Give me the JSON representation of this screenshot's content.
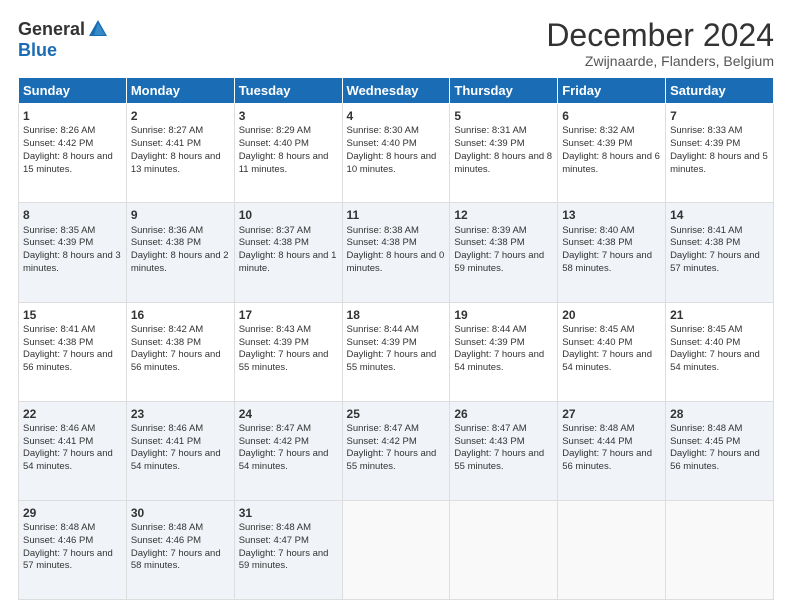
{
  "logo": {
    "general": "General",
    "blue": "Blue"
  },
  "header": {
    "title": "December 2024",
    "subtitle": "Zwijnaarde, Flanders, Belgium"
  },
  "days": [
    "Sunday",
    "Monday",
    "Tuesday",
    "Wednesday",
    "Thursday",
    "Friday",
    "Saturday"
  ],
  "weeks": [
    [
      {
        "day": "1",
        "sunrise": "8:26 AM",
        "sunset": "4:42 PM",
        "daylight": "8 hours and 15 minutes."
      },
      {
        "day": "2",
        "sunrise": "8:27 AM",
        "sunset": "4:41 PM",
        "daylight": "8 hours and 13 minutes."
      },
      {
        "day": "3",
        "sunrise": "8:29 AM",
        "sunset": "4:40 PM",
        "daylight": "8 hours and 11 minutes."
      },
      {
        "day": "4",
        "sunrise": "8:30 AM",
        "sunset": "4:40 PM",
        "daylight": "8 hours and 10 minutes."
      },
      {
        "day": "5",
        "sunrise": "8:31 AM",
        "sunset": "4:39 PM",
        "daylight": "8 hours and 8 minutes."
      },
      {
        "day": "6",
        "sunrise": "8:32 AM",
        "sunset": "4:39 PM",
        "daylight": "8 hours and 6 minutes."
      },
      {
        "day": "7",
        "sunrise": "8:33 AM",
        "sunset": "4:39 PM",
        "daylight": "8 hours and 5 minutes."
      }
    ],
    [
      {
        "day": "8",
        "sunrise": "8:35 AM",
        "sunset": "4:39 PM",
        "daylight": "8 hours and 3 minutes."
      },
      {
        "day": "9",
        "sunrise": "8:36 AM",
        "sunset": "4:38 PM",
        "daylight": "8 hours and 2 minutes."
      },
      {
        "day": "10",
        "sunrise": "8:37 AM",
        "sunset": "4:38 PM",
        "daylight": "8 hours and 1 minute."
      },
      {
        "day": "11",
        "sunrise": "8:38 AM",
        "sunset": "4:38 PM",
        "daylight": "8 hours and 0 minutes."
      },
      {
        "day": "12",
        "sunrise": "8:39 AM",
        "sunset": "4:38 PM",
        "daylight": "7 hours and 59 minutes."
      },
      {
        "day": "13",
        "sunrise": "8:40 AM",
        "sunset": "4:38 PM",
        "daylight": "7 hours and 58 minutes."
      },
      {
        "day": "14",
        "sunrise": "8:41 AM",
        "sunset": "4:38 PM",
        "daylight": "7 hours and 57 minutes."
      }
    ],
    [
      {
        "day": "15",
        "sunrise": "8:41 AM",
        "sunset": "4:38 PM",
        "daylight": "7 hours and 56 minutes."
      },
      {
        "day": "16",
        "sunrise": "8:42 AM",
        "sunset": "4:38 PM",
        "daylight": "7 hours and 56 minutes."
      },
      {
        "day": "17",
        "sunrise": "8:43 AM",
        "sunset": "4:39 PM",
        "daylight": "7 hours and 55 minutes."
      },
      {
        "day": "18",
        "sunrise": "8:44 AM",
        "sunset": "4:39 PM",
        "daylight": "7 hours and 55 minutes."
      },
      {
        "day": "19",
        "sunrise": "8:44 AM",
        "sunset": "4:39 PM",
        "daylight": "7 hours and 54 minutes."
      },
      {
        "day": "20",
        "sunrise": "8:45 AM",
        "sunset": "4:40 PM",
        "daylight": "7 hours and 54 minutes."
      },
      {
        "day": "21",
        "sunrise": "8:45 AM",
        "sunset": "4:40 PM",
        "daylight": "7 hours and 54 minutes."
      }
    ],
    [
      {
        "day": "22",
        "sunrise": "8:46 AM",
        "sunset": "4:41 PM",
        "daylight": "7 hours and 54 minutes."
      },
      {
        "day": "23",
        "sunrise": "8:46 AM",
        "sunset": "4:41 PM",
        "daylight": "7 hours and 54 minutes."
      },
      {
        "day": "24",
        "sunrise": "8:47 AM",
        "sunset": "4:42 PM",
        "daylight": "7 hours and 54 minutes."
      },
      {
        "day": "25",
        "sunrise": "8:47 AM",
        "sunset": "4:42 PM",
        "daylight": "7 hours and 55 minutes."
      },
      {
        "day": "26",
        "sunrise": "8:47 AM",
        "sunset": "4:43 PM",
        "daylight": "7 hours and 55 minutes."
      },
      {
        "day": "27",
        "sunrise": "8:48 AM",
        "sunset": "4:44 PM",
        "daylight": "7 hours and 56 minutes."
      },
      {
        "day": "28",
        "sunrise": "8:48 AM",
        "sunset": "4:45 PM",
        "daylight": "7 hours and 56 minutes."
      }
    ],
    [
      {
        "day": "29",
        "sunrise": "8:48 AM",
        "sunset": "4:46 PM",
        "daylight": "7 hours and 57 minutes."
      },
      {
        "day": "30",
        "sunrise": "8:48 AM",
        "sunset": "4:46 PM",
        "daylight": "7 hours and 58 minutes."
      },
      {
        "day": "31",
        "sunrise": "8:48 AM",
        "sunset": "4:47 PM",
        "daylight": "7 hours and 59 minutes."
      },
      null,
      null,
      null,
      null
    ]
  ]
}
